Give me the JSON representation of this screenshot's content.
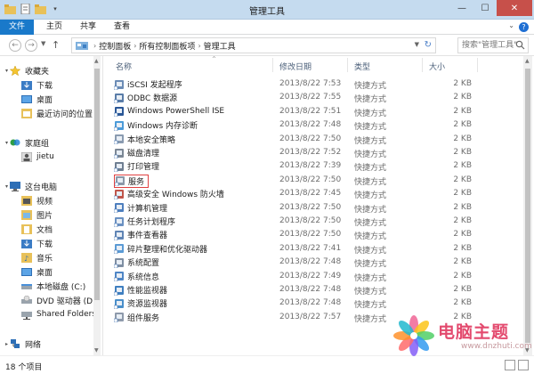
{
  "window": {
    "title": "管理工具"
  },
  "ribbon": {
    "tabs": [
      "文件",
      "主页",
      "共享",
      "查看"
    ]
  },
  "address": {
    "crumbs": [
      "控制面板",
      "所有控制面板项",
      "管理工具"
    ],
    "search_placeholder": "搜索\"管理工具\""
  },
  "nav": {
    "favorites": {
      "label": "收藏夹",
      "items": [
        "下载",
        "桌面",
        "最近访问的位置"
      ]
    },
    "homegroup": {
      "label": "家庭组",
      "items": [
        "jietu"
      ]
    },
    "computer": {
      "label": "这台电脑",
      "items": [
        "视频",
        "图片",
        "文档",
        "下载",
        "音乐",
        "桌面",
        "本地磁盘 (C:)",
        "DVD 驱动器 (D:)",
        "Shared Folders"
      ]
    },
    "network": {
      "label": "网络"
    }
  },
  "columns": {
    "name": "名称",
    "date": "修改日期",
    "type": "类型",
    "size": "大小"
  },
  "files": [
    {
      "name": "iSCSI 发起程序",
      "date": "2013/8/22 7:53",
      "type": "快捷方式",
      "size": "2 KB",
      "icon": "iscsi-icon"
    },
    {
      "name": "ODBC 数据源",
      "date": "2013/8/22 7:55",
      "type": "快捷方式",
      "size": "2 KB",
      "icon": "odbc-icon"
    },
    {
      "name": "Windows PowerShell ISE",
      "date": "2013/8/22 7:51",
      "type": "快捷方式",
      "size": "2 KB",
      "icon": "powershell-icon"
    },
    {
      "name": "Windows 内存诊断",
      "date": "2013/8/22 7:48",
      "type": "快捷方式",
      "size": "2 KB",
      "icon": "memory-diagnostic-icon"
    },
    {
      "name": "本地安全策略",
      "date": "2013/8/22 7:50",
      "type": "快捷方式",
      "size": "2 KB",
      "icon": "security-policy-icon"
    },
    {
      "name": "磁盘清理",
      "date": "2013/8/22 7:52",
      "type": "快捷方式",
      "size": "2 KB",
      "icon": "disk-cleanup-icon"
    },
    {
      "name": "打印管理",
      "date": "2013/8/22 7:39",
      "type": "快捷方式",
      "size": "2 KB",
      "icon": "print-management-icon"
    },
    {
      "name": "服务",
      "date": "2013/8/22 7:50",
      "type": "快捷方式",
      "size": "2 KB",
      "icon": "services-icon",
      "highlight": true
    },
    {
      "name": "高级安全 Windows 防火墙",
      "date": "2013/8/22 7:45",
      "type": "快捷方式",
      "size": "2 KB",
      "icon": "firewall-icon"
    },
    {
      "name": "计算机管理",
      "date": "2013/8/22 7:50",
      "type": "快捷方式",
      "size": "2 KB",
      "icon": "computer-management-icon"
    },
    {
      "name": "任务计划程序",
      "date": "2013/8/22 7:50",
      "type": "快捷方式",
      "size": "2 KB",
      "icon": "task-scheduler-icon"
    },
    {
      "name": "事件查看器",
      "date": "2013/8/22 7:50",
      "type": "快捷方式",
      "size": "2 KB",
      "icon": "event-viewer-icon"
    },
    {
      "name": "碎片整理和优化驱动器",
      "date": "2013/8/22 7:41",
      "type": "快捷方式",
      "size": "2 KB",
      "icon": "defrag-icon"
    },
    {
      "name": "系统配置",
      "date": "2013/8/22 7:48",
      "type": "快捷方式",
      "size": "2 KB",
      "icon": "system-config-icon"
    },
    {
      "name": "系统信息",
      "date": "2013/8/22 7:49",
      "type": "快捷方式",
      "size": "2 KB",
      "icon": "system-info-icon"
    },
    {
      "name": "性能监视器",
      "date": "2013/8/22 7:48",
      "type": "快捷方式",
      "size": "2 KB",
      "icon": "performance-monitor-icon"
    },
    {
      "name": "资源监视器",
      "date": "2013/8/22 7:48",
      "type": "快捷方式",
      "size": "2 KB",
      "icon": "resource-monitor-icon"
    },
    {
      "name": "组件服务",
      "date": "2013/8/22 7:57",
      "type": "快捷方式",
      "size": "2 KB",
      "icon": "component-services-icon"
    }
  ],
  "status": {
    "count": "18 个项目"
  },
  "watermark": {
    "brand": "电脑主题",
    "url": "www.dnzhuti.com"
  },
  "colors": {
    "file_tab": "#1979ca",
    "titlebar": "#c5dbef",
    "highlight_border": "#e04040",
    "close": "#c7504a"
  }
}
